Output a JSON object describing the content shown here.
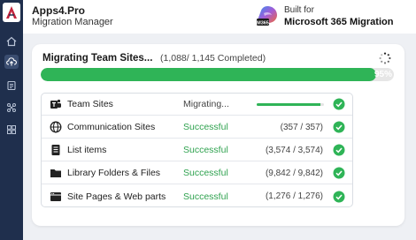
{
  "app": {
    "title": "Apps4.Pro",
    "subtitle": "Migration Manager"
  },
  "brand": {
    "built_for": "Built for",
    "product": "Microsoft 365 Migration",
    "logo_badge": "M365"
  },
  "sidebar": {
    "items": [
      {
        "icon": "home-icon"
      },
      {
        "icon": "cloud-upload-icon",
        "active": true
      },
      {
        "icon": "report-icon"
      },
      {
        "icon": "connections-icon"
      },
      {
        "icon": "grid-icon"
      }
    ]
  },
  "job": {
    "title": "Migrating Team Sites...",
    "count": "(1,088/ 1,145 Completed)",
    "progress": 0.95,
    "progress_label": "95%"
  },
  "rows": [
    {
      "name": "Team Sites",
      "icon": "teams-icon",
      "status": "Migrating...",
      "state": "migrating",
      "count": "",
      "progress": 0.95
    },
    {
      "name": "Communication Sites",
      "icon": "globe-icon",
      "status": "Successful",
      "state": "successful",
      "count": "(357 / 357)"
    },
    {
      "name": "List items",
      "icon": "list-icon",
      "status": "Successful",
      "state": "successful",
      "count": "(3,574 / 3,574)"
    },
    {
      "name": "Library Folders & Files",
      "icon": "folder-icon",
      "status": "Successful",
      "state": "successful",
      "count": "(9,842 / 9,842)"
    },
    {
      "name": "Site Pages & Web parts",
      "icon": "pages-icon",
      "status": "Successful",
      "state": "successful",
      "count": "(1,276 / 1,276)"
    }
  ],
  "colors": {
    "rail": "#1f2f4d",
    "success": "#2fb457",
    "success_text": "#2fa24f"
  }
}
